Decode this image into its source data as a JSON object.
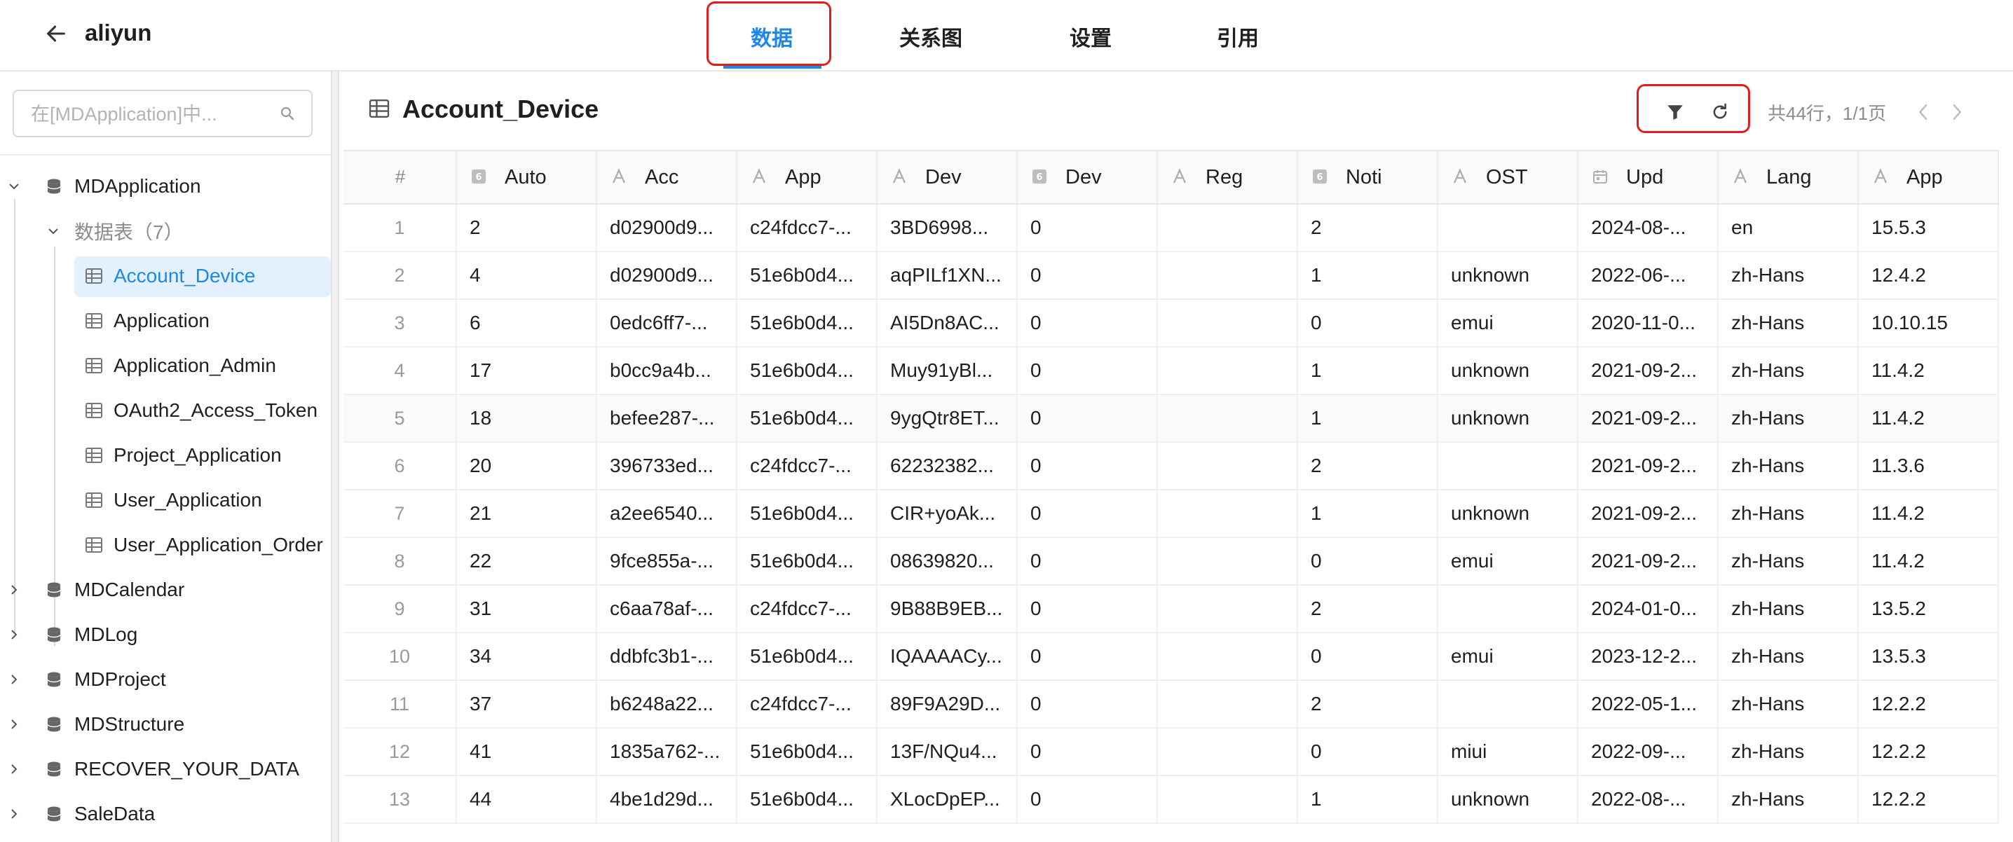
{
  "header": {
    "title": "aliyun",
    "tabs": [
      {
        "label": "数据",
        "active": true
      },
      {
        "label": "关系图",
        "active": false
      },
      {
        "label": "设置",
        "active": false
      },
      {
        "label": "引用",
        "active": false
      }
    ]
  },
  "sidebar": {
    "search_placeholder": "在[MDApplication]中...",
    "databases": [
      {
        "name": "MDApplication",
        "expanded": true
      },
      {
        "name": "MDCalendar"
      },
      {
        "name": "MDLog"
      },
      {
        "name": "MDProject"
      },
      {
        "name": "MDStructure"
      },
      {
        "name": "RECOVER_YOUR_DATA"
      },
      {
        "name": "SaleData"
      }
    ],
    "tables_group": "数据表（7）",
    "tables": [
      "Account_Device",
      "Application",
      "Application_Admin",
      "OAuth2_Access_Token",
      "Project_Application",
      "User_Application",
      "User_Application_Order"
    ],
    "selected_table": "Account_Device"
  },
  "main": {
    "table_title": "Account_Device",
    "page_info": "共44行，1/1页",
    "columns": [
      {
        "label": "#",
        "type": "rownum"
      },
      {
        "label": "Auto",
        "type": "number"
      },
      {
        "label": "Acc",
        "type": "text"
      },
      {
        "label": "App",
        "type": "text"
      },
      {
        "label": "Dev",
        "type": "text"
      },
      {
        "label": "Dev",
        "type": "number"
      },
      {
        "label": "Reg",
        "type": "text"
      },
      {
        "label": "Noti",
        "type": "number"
      },
      {
        "label": "OST",
        "type": "text"
      },
      {
        "label": "Upd",
        "type": "date"
      },
      {
        "label": "Lang",
        "type": "text"
      },
      {
        "label": "App",
        "type": "text"
      }
    ],
    "rows": [
      [
        "1",
        "2",
        "d02900d9...",
        "c24fdcc7-...",
        "3BD6998...",
        "0",
        "",
        "2",
        "",
        "2024-08-...",
        "en",
        "15.5.3"
      ],
      [
        "2",
        "4",
        "d02900d9...",
        "51e6b0d4...",
        "aqPILf1XN...",
        "0",
        "",
        "1",
        "unknown",
        "2022-06-...",
        "zh-Hans",
        "12.4.2"
      ],
      [
        "3",
        "6",
        "0edc6ff7-...",
        "51e6b0d4...",
        "AI5Dn8AC...",
        "0",
        "",
        "0",
        "emui",
        "2020-11-0...",
        "zh-Hans",
        "10.10.15"
      ],
      [
        "4",
        "17",
        "b0cc9a4b...",
        "51e6b0d4...",
        "Muy91yBl...",
        "0",
        "",
        "1",
        "unknown",
        "2021-09-2...",
        "zh-Hans",
        "11.4.2"
      ],
      [
        "5",
        "18",
        "befee287-...",
        "51e6b0d4...",
        "9ygQtr8ET...",
        "0",
        "",
        "1",
        "unknown",
        "2021-09-2...",
        "zh-Hans",
        "11.4.2"
      ],
      [
        "6",
        "20",
        "396733ed...",
        "c24fdcc7-...",
        "62232382...",
        "0",
        "",
        "2",
        "",
        "2021-09-2...",
        "zh-Hans",
        "11.3.6"
      ],
      [
        "7",
        "21",
        "a2ee6540...",
        "51e6b0d4...",
        "CIR+yoAk...",
        "0",
        "",
        "1",
        "unknown",
        "2021-09-2...",
        "zh-Hans",
        "11.4.2"
      ],
      [
        "8",
        "22",
        "9fce855a-...",
        "51e6b0d4...",
        "08639820...",
        "0",
        "",
        "0",
        "emui",
        "2021-09-2...",
        "zh-Hans",
        "11.4.2"
      ],
      [
        "9",
        "31",
        "c6aa78af-...",
        "c24fdcc7-...",
        "9B88B9EB...",
        "0",
        "",
        "2",
        "",
        "2024-01-0...",
        "zh-Hans",
        "13.5.2"
      ],
      [
        "10",
        "34",
        "ddbfc3b1-...",
        "51e6b0d4...",
        "IQAAAACy...",
        "0",
        "",
        "0",
        "emui",
        "2023-12-2...",
        "zh-Hans",
        "13.5.3"
      ],
      [
        "11",
        "37",
        "b6248a22...",
        "c24fdcc7-...",
        "89F9A29D...",
        "0",
        "",
        "2",
        "",
        "2022-05-1...",
        "zh-Hans",
        "12.2.2"
      ],
      [
        "12",
        "41",
        "1835a762-...",
        "51e6b0d4...",
        "13F/NQu4...",
        "0",
        "",
        "0",
        "miui",
        "2022-09-...",
        "zh-Hans",
        "12.2.2"
      ],
      [
        "13",
        "44",
        "4be1d29d...",
        "51e6b0d4...",
        "XLocDpEP...",
        "0",
        "",
        "1",
        "unknown",
        "2022-08-...",
        "zh-Hans",
        "12.2.2"
      ]
    ]
  },
  "colors": {
    "accent": "#1e88e5",
    "highlight": "#e61c1c",
    "selected_bg": "#e3f0fd"
  },
  "icons": {
    "back": "arrow-left-icon",
    "search": "search-icon",
    "database": "database-icon",
    "table": "table-icon",
    "filter": "filter-icon",
    "refresh": "refresh-icon",
    "prev": "chevron-left-icon",
    "next": "chevron-right-icon"
  }
}
